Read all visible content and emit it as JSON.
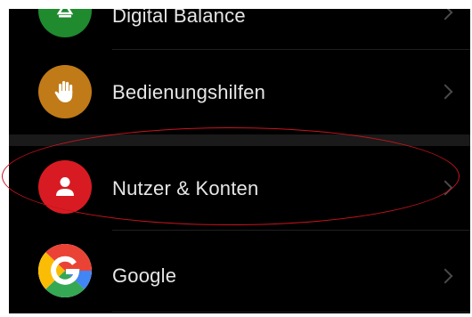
{
  "settings": {
    "items": [
      {
        "label": "Digital Balance",
        "icon": "digital-balance-icon",
        "color": "#1f8a2e"
      },
      {
        "label": "Bedienungshilfen",
        "icon": "hand-icon",
        "color": "#c07a17"
      },
      {
        "label": "Nutzer & Konten",
        "icon": "user-icon",
        "color": "#d81b22"
      },
      {
        "label": "Google",
        "icon": "google-icon",
        "color": "#ffffff"
      }
    ]
  },
  "annotation": {
    "color": "#c8141e",
    "shape": "oval"
  }
}
